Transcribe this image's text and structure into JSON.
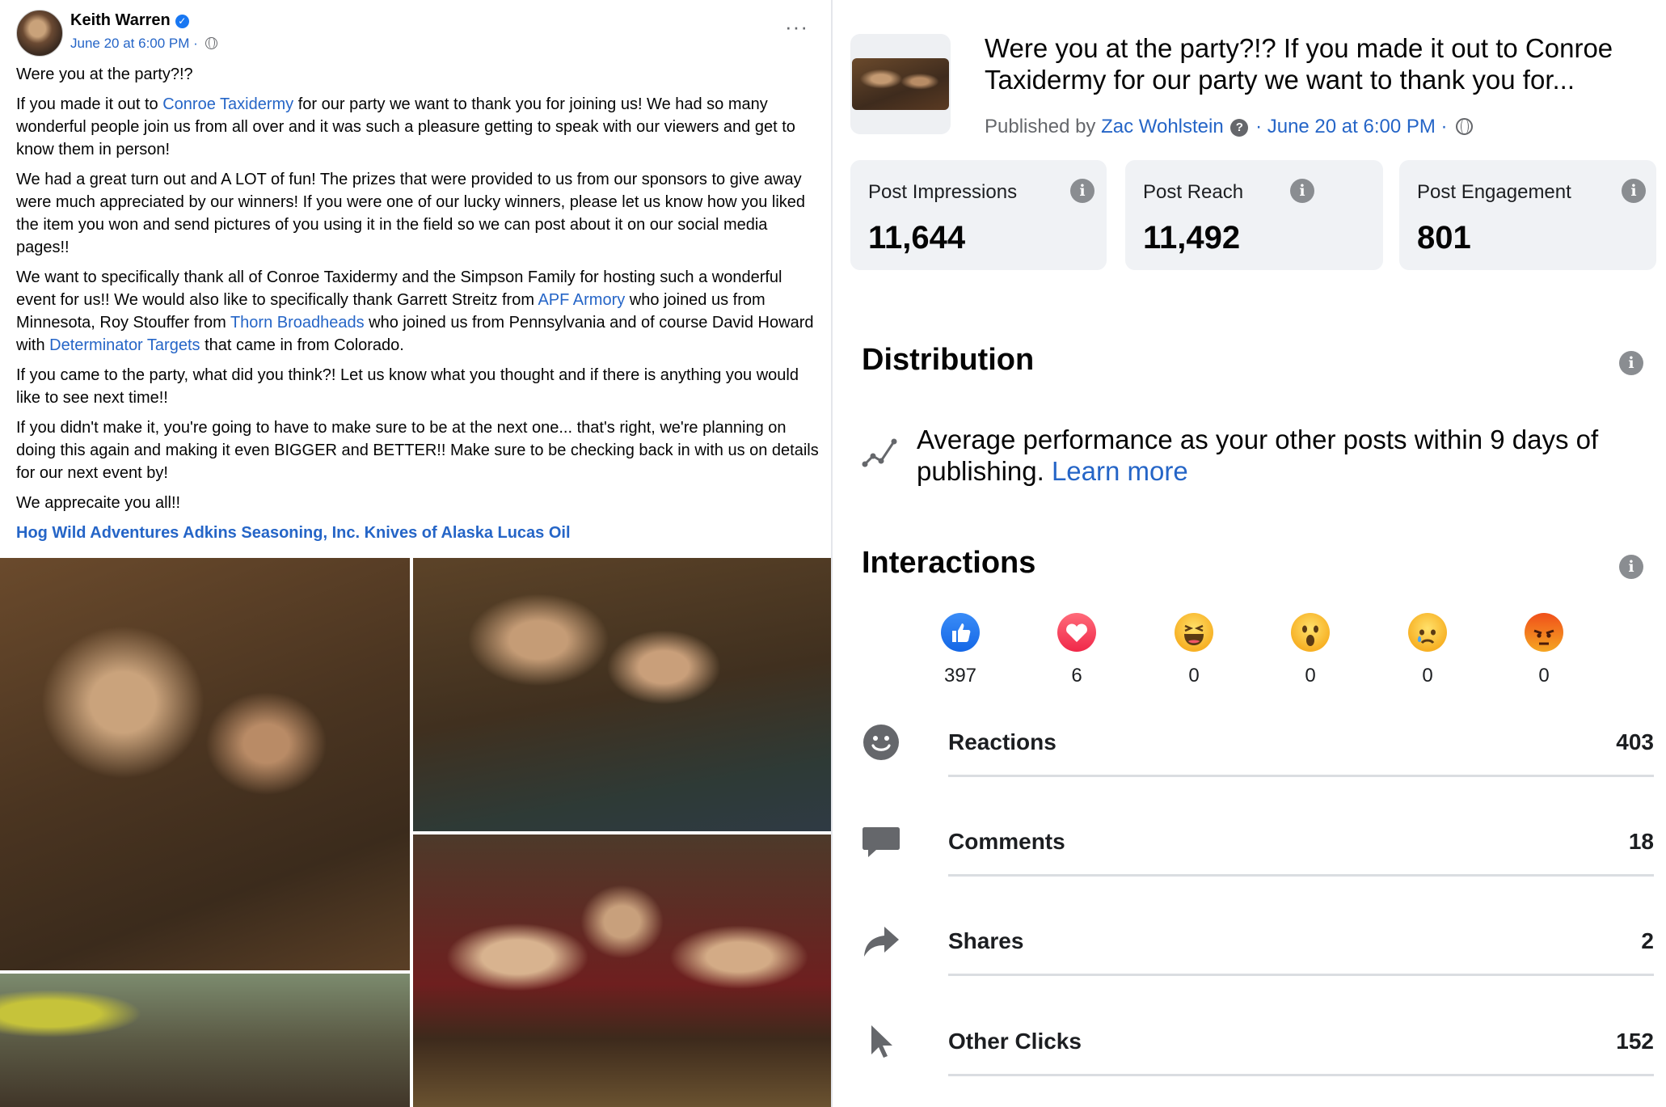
{
  "post": {
    "author": "Keith Warren",
    "date": "June 20 at 6:00 PM",
    "date_sep": "·",
    "more": "···",
    "p1": "Were you at the party?!?",
    "p2_a": "If you made it out to ",
    "p2_link": "Conroe Taxidermy",
    "p2_b": " for our party we want to thank you for joining us! We had so many wonderful people join us from all over and it was such a pleasure getting to speak with our viewers and get to know them in person!",
    "p3": "We had a great turn out and A LOT of fun! The prizes that were provided to us from our sponsors to give away were much appreciated by our winners! If you were one of our lucky winners, please let us know how you liked the item you won and send pictures of you using it in the field so we can post about it on our social media pages!!",
    "p4_a": "We want to specifically thank all of Conroe Taxidermy and the Simpson Family for hosting such a wonderful event for us!! We would also like to specifically thank Garrett Streitz from ",
    "p4_link1": "APF Armory",
    "p4_b": " who joined us from Minnesota, Roy Stouffer from ",
    "p4_link2": "Thorn Broadheads",
    "p4_c": " who joined us from Pennsylvania and of course David Howard with ",
    "p4_link3": "Determinator Targets",
    "p4_d": "  that came in from Colorado.",
    "p5": "If you came to the party, what did you think?! Let us know what you thought and if there is anything you would like to see next time!!",
    "p6": "If you didn't make it, you're going to have to make sure to be at the next one... that's right, we're planning on doing this again and making it even BIGGER and BETTER!! Make sure to be checking back in with us on details for our next event by!",
    "p7": "We apprecaite you all!!",
    "tags": "Hog Wild Adventures Adkins Seasoning, Inc. Knives of Alaska Lucas Oil"
  },
  "insights": {
    "title": "Were you at the party?!? If you made it out to Conroe Taxidermy for our party we want to thank you for...",
    "published_prefix": "Published by ",
    "published_by": "Zac Wohlstein",
    "published_date": "· June 20 at 6:00 PM ·",
    "stats": [
      {
        "label": "Post Impressions",
        "value": "11,644"
      },
      {
        "label": "Post Reach",
        "value": "11,492"
      },
      {
        "label": "Post Engagement",
        "value": "801"
      }
    ],
    "distribution": {
      "title": "Distribution",
      "text": "Average performance as your other posts within 9 days of publishing.",
      "learn_more": "Learn more"
    },
    "interactions": {
      "title": "Interactions",
      "reactions": [
        {
          "type": "like",
          "count": "397"
        },
        {
          "type": "love",
          "count": "6"
        },
        {
          "type": "haha",
          "count": "0"
        },
        {
          "type": "wow",
          "count": "0"
        },
        {
          "type": "sad",
          "count": "0"
        },
        {
          "type": "angry",
          "count": "0"
        }
      ],
      "metrics": [
        {
          "label": "Reactions",
          "value": "403",
          "icon": "smile-icon"
        },
        {
          "label": "Comments",
          "value": "18",
          "icon": "comment-icon"
        },
        {
          "label": "Shares",
          "value": "2",
          "icon": "share-icon"
        },
        {
          "label": "Other Clicks",
          "value": "152",
          "icon": "cursor-icon"
        }
      ]
    }
  }
}
